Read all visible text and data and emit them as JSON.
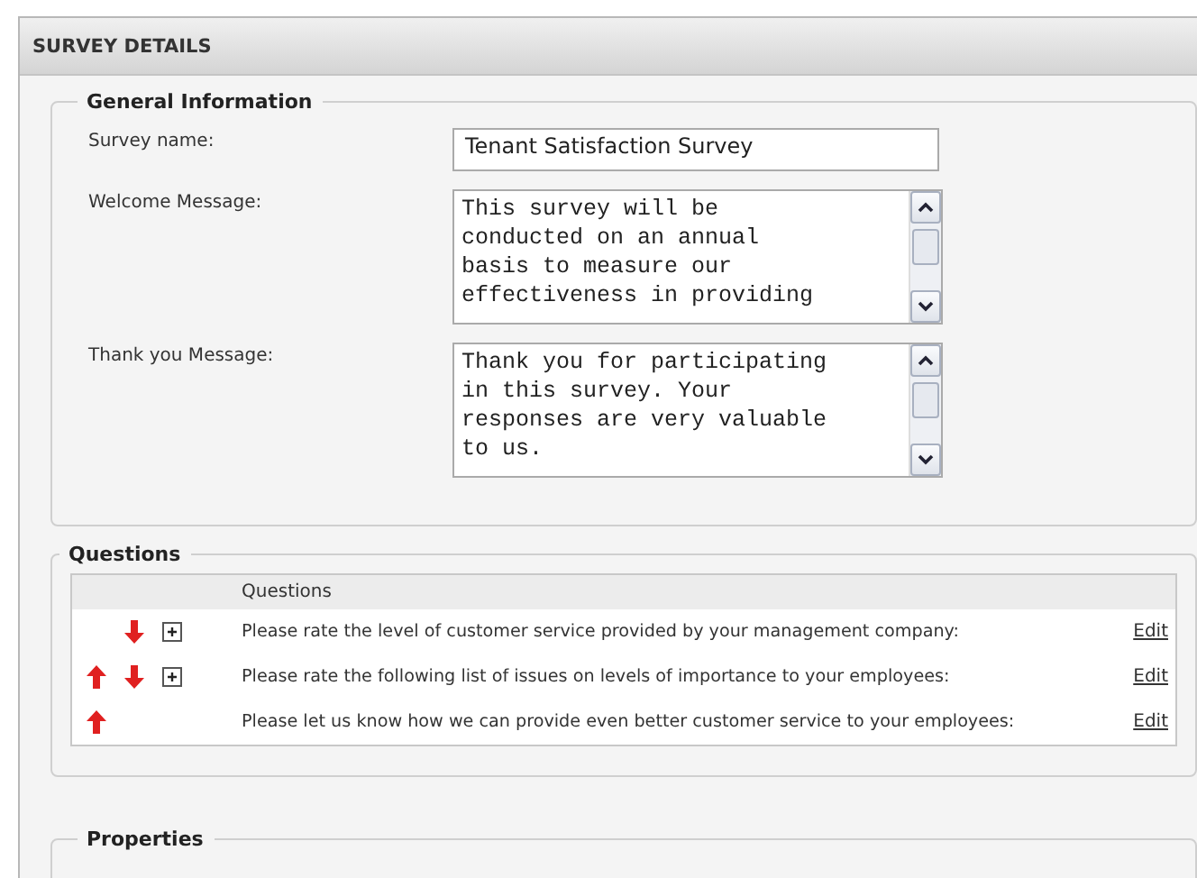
{
  "panel": {
    "title": "SURVEY DETAILS"
  },
  "general": {
    "legend": "General Information",
    "fields": [
      {
        "kind": "input",
        "label": "Survey name:",
        "value": "Tenant Satisfaction Survey"
      },
      {
        "kind": "textarea",
        "label": "Welcome Message:",
        "value": "This survey will be conducted on an annual basis to measure our effectiveness in providing"
      },
      {
        "kind": "textarea",
        "label": "Thank you Message:",
        "value": "Thank you for participating in this survey. Your responses are very valuable to us."
      }
    ]
  },
  "questions": {
    "legend": "Questions",
    "column": "Questions",
    "rows": [
      {
        "move_up": false,
        "move_down": true,
        "expandable": true,
        "text": "Please rate the level of customer service provided by your management company:",
        "action": "Edit"
      },
      {
        "move_up": true,
        "move_down": true,
        "expandable": true,
        "text": "Please rate the following list of issues on levels of importance to your employees:",
        "action": "Edit"
      },
      {
        "move_up": true,
        "move_down": false,
        "expandable": false,
        "text": "Please let us know how we can provide even better customer service to your employees:",
        "action": "Edit"
      }
    ]
  },
  "properties": {
    "legend": "Properties"
  }
}
